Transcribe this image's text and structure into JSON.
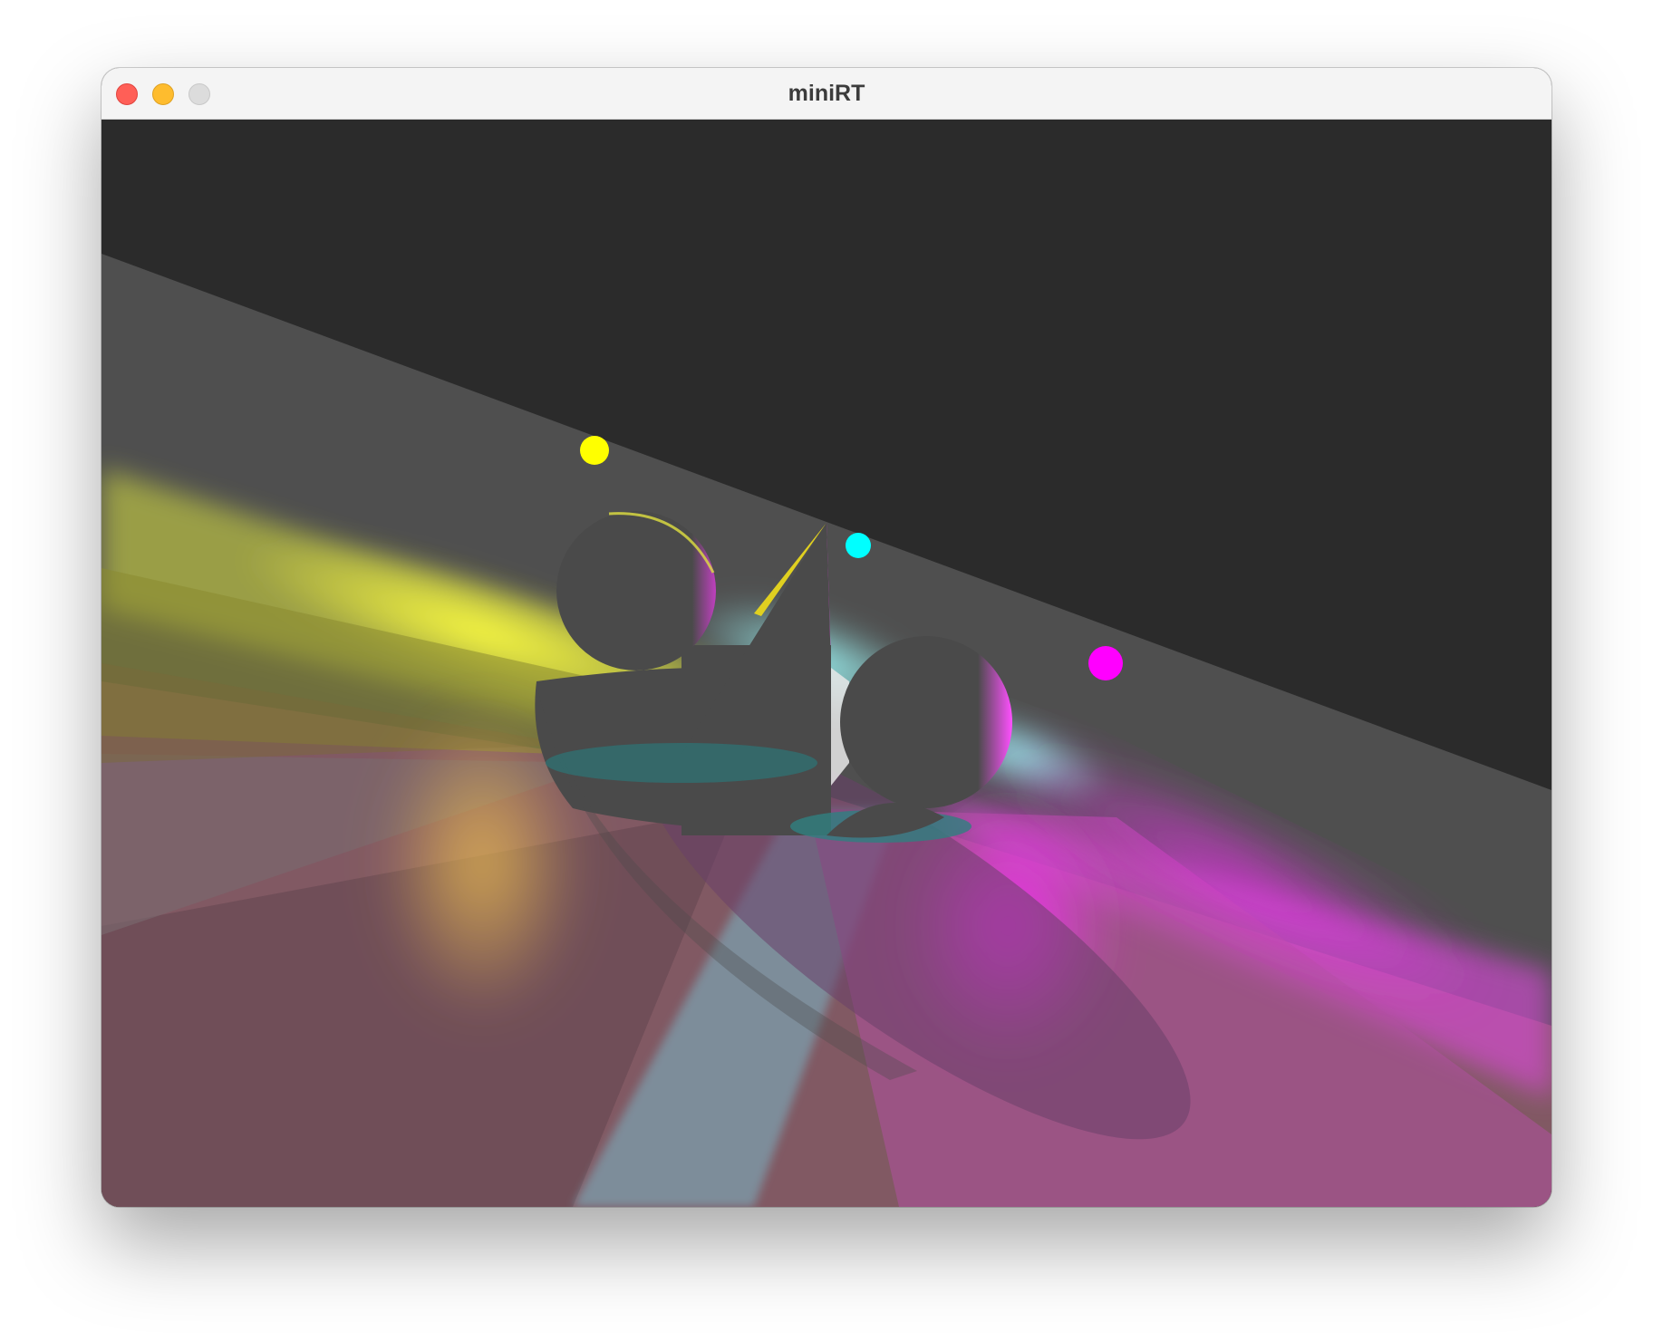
{
  "window": {
    "title": "miniRT"
  },
  "traffic_lights": {
    "close": {
      "color": "#ff5f57",
      "border": "#e0443e",
      "icon": "close-icon"
    },
    "minimize": {
      "color": "#febc2e",
      "border": "#dea123",
      "icon": "minimize-icon"
    },
    "zoom": {
      "color": "#dcdcdc",
      "border": "#c8c8c8",
      "icon": "zoom-icon"
    }
  },
  "scene": {
    "background": "#2b2b2b",
    "plane_color": "#4f4f4f",
    "object_color": "#4a4a4a",
    "lights": [
      {
        "name": "yellow",
        "color": "#ffff00"
      },
      {
        "name": "cyan",
        "color": "#00ffff"
      },
      {
        "name": "magenta",
        "color": "#ff00ff"
      }
    ]
  }
}
